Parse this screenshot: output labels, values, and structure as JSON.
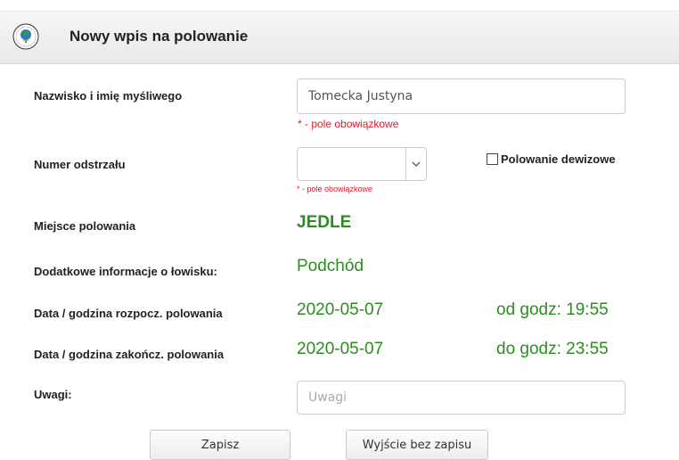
{
  "header": {
    "title": "Nowy wpis na polowanie",
    "logo_icon": "hunting-association-logo-icon"
  },
  "form": {
    "hunter_name": {
      "label": "Nazwisko i imię myśliwego",
      "value": "Tomecka Justyna",
      "required_note": "* - pole obowiązkowe"
    },
    "shooting_number": {
      "label": "Numer odstrzału",
      "selected_value": "",
      "required_note": "* - pole obowiązkowe",
      "dropdown_icon": "chevron-down-icon"
    },
    "foreign_hunt": {
      "label": "Polowanie dewizowe",
      "checked": false
    },
    "hunt_place": {
      "label": "Miejsce polowania",
      "value": "JEDLE"
    },
    "extra_info": {
      "label": "Dodatkowe informacje o łowisku:",
      "value": "Podchód"
    },
    "start": {
      "label": "Data / godzina rozpocz. polowania",
      "date": "2020-05-07",
      "time": "od godz: 19:55"
    },
    "end": {
      "label": "Data / godzina zakończ. polowania",
      "date": "2020-05-07",
      "time": "do godz: 23:55"
    },
    "notes": {
      "label": "Uwagi:",
      "value": "",
      "placeholder": "Uwagi"
    }
  },
  "buttons": {
    "save": "Zapisz",
    "exit": "Wyjście bez zapisu"
  },
  "colors": {
    "value_green": "#2e8b22",
    "required_red": "#e0192b"
  }
}
